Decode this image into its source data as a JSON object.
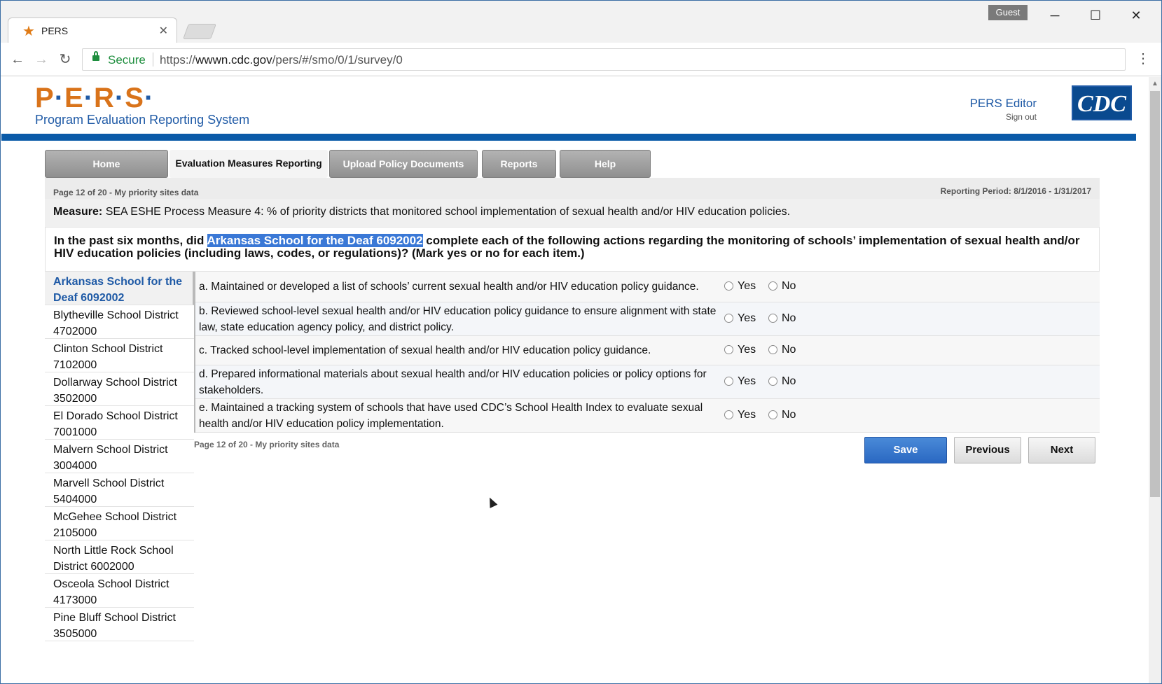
{
  "browser": {
    "tab_title": "PERS",
    "profile": "Guest",
    "secure_label": "Secure",
    "url_scheme": "https://",
    "url_host": "wwwn.cdc.gov",
    "url_path": "/pers/#/smo/0/1/survey/0",
    "icons": {
      "back": "←",
      "forward": "→",
      "reload": "↻",
      "menu": "⋮",
      "minimize": "─",
      "maximize": "☐",
      "close": "✕",
      "tab_close": "✕",
      "favicon": "★"
    }
  },
  "header": {
    "logo_letters": [
      "P",
      "E",
      "R",
      "S"
    ],
    "logo_subtitle": "Program Evaluation Reporting System",
    "user_name": "PERS Editor",
    "sign_out": "Sign out",
    "agency_logo": "CDC"
  },
  "nav": {
    "tabs": [
      {
        "label": "Home"
      },
      {
        "label": "Evaluation Measures Reporting"
      },
      {
        "label": "Upload Policy Documents"
      },
      {
        "label": "Reports"
      },
      {
        "label": "Help"
      }
    ]
  },
  "content": {
    "page_info": "Page 12 of 20 - My priority sites data",
    "reporting_period": "Reporting Period: 8/1/2016 - 1/31/2017",
    "measure_label": "Measure:",
    "measure_text": " SEA ESHE Process Measure 4: % of priority districts that monitored school implementation of sexual health and/or HIV education policies.",
    "question_prefix": "In the past six months, did ",
    "question_highlight": "Arkansas School for the Deaf 6092002",
    "question_suffix": " complete each of the following actions regarding the monitoring of schools’ implementation of sexual health and/or HIV education policies (including laws, codes, or regulations)? (Mark yes or no for each item.)"
  },
  "sidebar": {
    "items": [
      {
        "label": "Arkansas School for the Deaf 6092002"
      },
      {
        "label": "Blytheville School District 4702000"
      },
      {
        "label": "Clinton School District 7102000"
      },
      {
        "label": "Dollarway School District 3502000"
      },
      {
        "label": "El Dorado School District 7001000"
      },
      {
        "label": "Malvern School District 3004000"
      },
      {
        "label": "Marvell School District 5404000"
      },
      {
        "label": "McGehee School District 2105000"
      },
      {
        "label": "North Little Rock School District 6002000"
      },
      {
        "label": "Osceola School District 4173000"
      },
      {
        "label": "Pine Bluff School District 3505000"
      }
    ]
  },
  "items": [
    {
      "text": "a. Maintained or developed a list of schools’ current sexual health and/or HIV education policy guidance.",
      "yes": "Yes",
      "no": "No"
    },
    {
      "text": "b. Reviewed school-level sexual health and/or HIV education policy guidance to ensure alignment with state law, state education agency policy, and district policy.",
      "yes": "Yes",
      "no": "No"
    },
    {
      "text": "c. Tracked school-level implementation of sexual health and/or HIV education policy guidance.",
      "yes": "Yes",
      "no": "No"
    },
    {
      "text": "d. Prepared informational materials about sexual health and/or HIV education policies or policy options for stakeholders.",
      "yes": "Yes",
      "no": "No"
    },
    {
      "text": "e. Maintained a tracking system of schools that have used CDC’s School Health Index to evaluate sexual health and/or HIV education policy implementation.",
      "yes": "Yes",
      "no": "No"
    }
  ],
  "footer": {
    "page_info": "Page 12 of 20 - My priority sites data",
    "save": "Save",
    "previous": "Previous",
    "next": "Next"
  },
  "colors": {
    "brand_orange": "#d9731a",
    "brand_blue": "#1f5aa6",
    "header_bar": "#0a5aa8",
    "save_button": "#2a68c2"
  }
}
